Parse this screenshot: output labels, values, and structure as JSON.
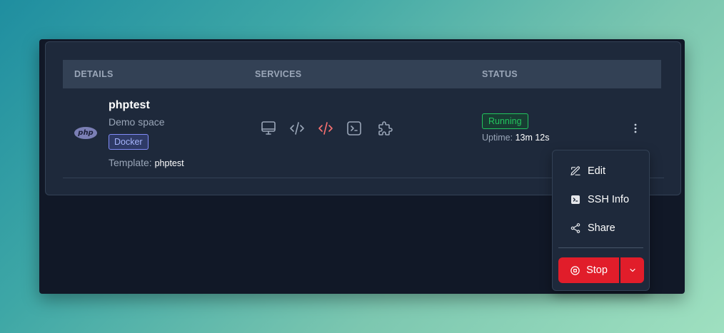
{
  "table": {
    "headers": {
      "details": "DETAILS",
      "services": "SERVICES",
      "status": "STATUS"
    }
  },
  "space": {
    "logo_text": "php",
    "name": "phptest",
    "description": "Demo space",
    "type_badge": "Docker",
    "template_label": "Template:",
    "template_value": "phptest",
    "status": "Running",
    "uptime_label": "Uptime:",
    "uptime_value": "13m 12s",
    "services": [
      "desktop-icon",
      "code-icon",
      "code-icon",
      "terminal-icon",
      "puzzle-icon"
    ],
    "colors": {
      "accent_red": "#f87171",
      "running_green": "#22c55e",
      "docker_badge": "#818cf8"
    }
  },
  "menu": {
    "edit": "Edit",
    "ssh_info": "SSH Info",
    "share": "Share",
    "stop": "Stop",
    "colors": {
      "stop": "#e11d2a"
    }
  }
}
